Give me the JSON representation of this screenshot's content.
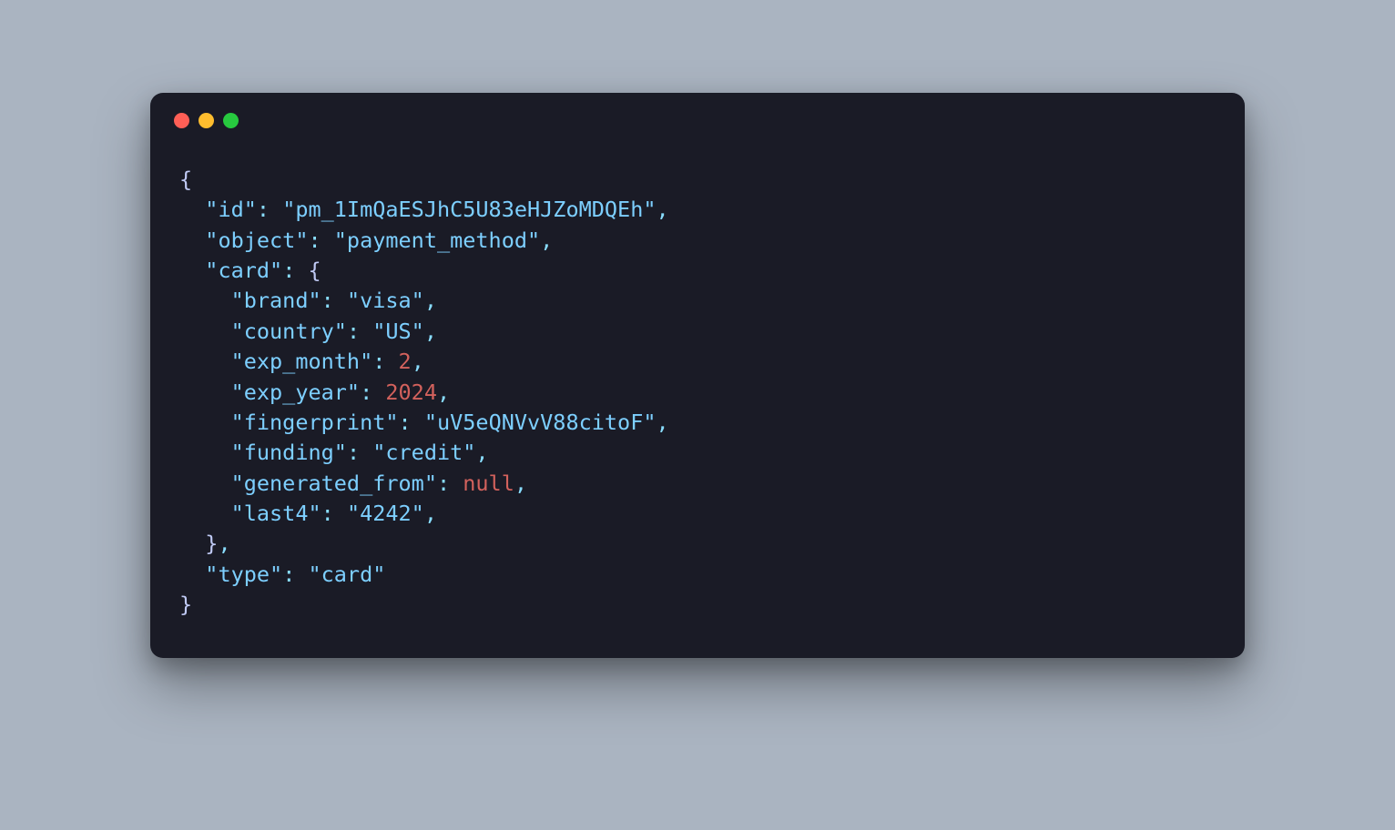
{
  "window": {
    "dots": [
      "red",
      "yellow",
      "green"
    ]
  },
  "code": {
    "open_brace": "{",
    "close_brace": "}",
    "indent1": "  ",
    "indent2": "    ",
    "colon_sep": ": ",
    "comma": ",",
    "keys": {
      "id": "\"id\"",
      "object": "\"object\"",
      "card": "\"card\"",
      "brand": "\"brand\"",
      "country": "\"country\"",
      "exp_month": "\"exp_month\"",
      "exp_year": "\"exp_year\"",
      "fingerprint": "\"fingerprint\"",
      "funding": "\"funding\"",
      "generated_from": "\"generated_from\"",
      "last4": "\"last4\"",
      "type": "\"type\""
    },
    "values": {
      "id": "\"pm_1ImQaESJhC5U83eHJZoMDQEh\"",
      "object": "\"payment_method\"",
      "brand": "\"visa\"",
      "country": "\"US\"",
      "exp_month": "2",
      "exp_year": "2024",
      "fingerprint": "\"uV5eQNVvV88citoF\"",
      "funding": "\"credit\"",
      "generated_from": "null",
      "last4": "\"4242\"",
      "type": "\"card\""
    }
  }
}
